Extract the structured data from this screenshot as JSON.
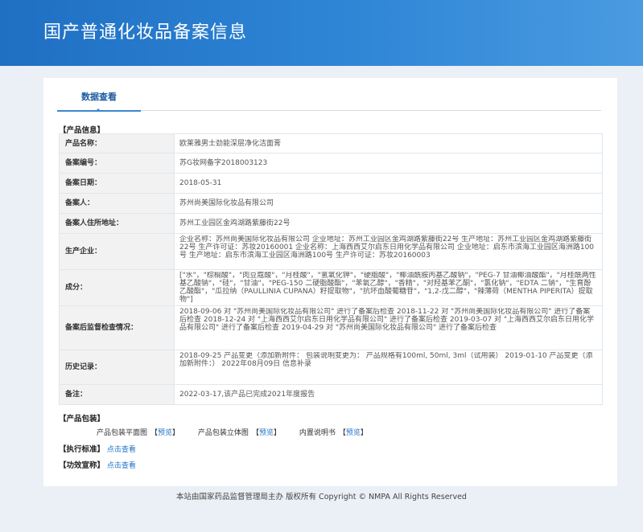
{
  "header": {
    "title": "国产普通化妆品备案信息"
  },
  "tabs": [
    {
      "label": "数据查看"
    }
  ],
  "product_info": {
    "section_title": "【产品信息】",
    "rows": [
      {
        "label": "产品名称：",
        "value": "欧莱雅男士劲能深层净化洁面膏"
      },
      {
        "label": "备案编号：",
        "value": "苏G妆网备字2018003123"
      },
      {
        "label": "备案日期：",
        "value": "2018-05-31"
      },
      {
        "label": "备案人：",
        "value": "苏州尚美国际化妆品有限公司"
      },
      {
        "label": "备案人住所地址：",
        "value": "苏州工业园区金鸡湖路紫藤街22号"
      },
      {
        "label": "生产企业：",
        "value": "企业名称：苏州尚美国际化妆品有限公司 企业地址：苏州工业园区金鸡湖路紫藤街22号 生产地址：苏州工业园区金鸡湖路紫藤街22号 生产许可证：苏妆20160001 企业名称：上海西西艾尔启东日用化学品有限公司 企业地址：启东市滨海工业园区海洲路100号 生产地址：启东市滨海工业园区海洲路100号 生产许可证：苏妆20160003"
      },
      {
        "label": "成分：",
        "value": "[\"水\"，\"棕榈酸\"，\"肉豆蔻酸\"，\"月桂酸\"，\"氢氧化钾\"，\"硬脂酸\"，\"椰油酰胺丙基乙酸钠\"，\"PEG-7 甘油椰油酸酯\"，\"月桂酰两性基乙酸钠\"，\"硅\"，\"甘油\"，\"PEG-150 二硬脂酸酯\"，\"苯氧乙醇\"，\"香精\"，\"对羟基苯乙酮\"，\"氯化钠\"，\"EDTA 二钠\"，\"生育酚乙酸酯\"，\"瓜拉纳（PAULLINIA CUPANA）籽提取物\"，\"抗坏血酸葡糖苷\"，\"1,2-戊二醇\"，\"辣薄荷（MENTHA PIPERITA）提取物\"]"
      },
      {
        "label": "备案后监督检查情况：",
        "value": "2018-09-06 对 \"苏州尚美国际化妆品有限公司\" 进行了备案后检查 2018-11-22 对 \"苏州尚美国际化妆品有限公司\" 进行了备案后检查 2018-12-24 对 \"上海西西艾尔启东日用化学品有限公司\" 进行了备案后检查 2019-03-07 对 \"上海西西艾尔启东日用化学品有限公司\" 进行了备案后检查 2019-04-29 对 \"苏州尚美国际化妆品有限公司\" 进行了备案后检查"
      },
      {
        "label": "历史记录：",
        "value": "2018-09-25 产品变更（添加新附件： 包装说明变更为： 产品规格有100ml, 50ml, 3ml（试用装） 2019-01-10 产品变更（添加新附件：） 2022年08月09日 信息补录"
      },
      {
        "label": "备注：",
        "value": "2022-03-17,该产品已完成2021年度报告"
      }
    ]
  },
  "packaging": {
    "section_title": "【产品包装】",
    "items": [
      {
        "label": "产品包装平面图",
        "link": "预览"
      },
      {
        "label": "产品包装立体图",
        "link": "预览"
      },
      {
        "label": "内置说明书",
        "link": "预览"
      }
    ]
  },
  "standard": {
    "section_title": "【执行标准】",
    "link": "点击查看"
  },
  "efficacy": {
    "section_title": "【功效宣称】",
    "link": "点击查看"
  },
  "footer": {
    "text": "本站由国家药品监督管理局主办 版权所有 Copyright © NMPA All Rights Reserved"
  }
}
